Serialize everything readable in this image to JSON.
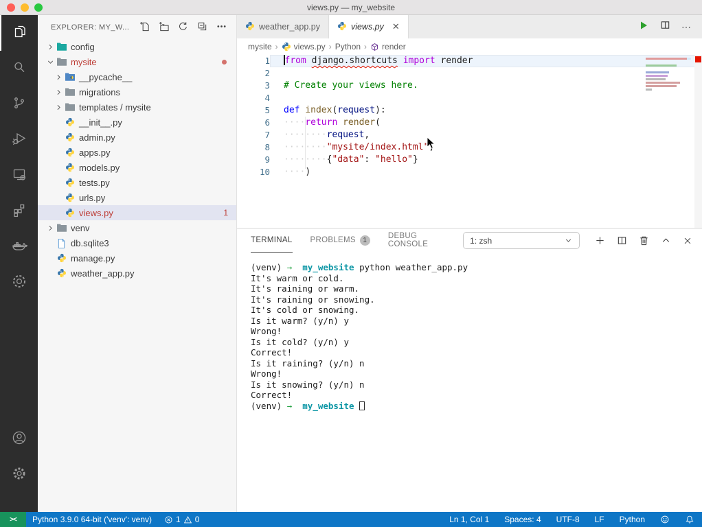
{
  "window": {
    "title": "views.py — my_website"
  },
  "activity_bar": {
    "top_items": [
      {
        "name": "explorer",
        "icon": "files-icon",
        "active": true
      },
      {
        "name": "search",
        "icon": "search-icon",
        "active": false
      },
      {
        "name": "source-control",
        "icon": "source-control-icon",
        "active": false
      },
      {
        "name": "run-and-debug",
        "icon": "run-debug-icon",
        "active": false
      },
      {
        "name": "remote-explorer",
        "icon": "remote-explorer-icon",
        "active": false
      },
      {
        "name": "extensions",
        "icon": "extensions-icon",
        "active": false
      },
      {
        "name": "docker",
        "icon": "docker-icon",
        "active": false
      },
      {
        "name": "python-environment",
        "icon": "circular-gear-icon",
        "active": false
      }
    ],
    "bottom_items": [
      {
        "name": "account",
        "icon": "account-icon"
      },
      {
        "name": "settings",
        "icon": "settings-gear-icon"
      }
    ]
  },
  "sidebar": {
    "header": "EXPLORER: MY_W...",
    "actions": [
      {
        "name": "new-file",
        "icon": "new-file-icon"
      },
      {
        "name": "new-folder",
        "icon": "new-folder-icon"
      },
      {
        "name": "refresh-explorer",
        "icon": "refresh-icon"
      },
      {
        "name": "collapse-folders",
        "icon": "collapse-folders-icon"
      },
      {
        "name": "more-actions",
        "icon": "more-actions-icon"
      }
    ],
    "tree": [
      {
        "label": "config",
        "indent": 0,
        "expandable": true,
        "expanded": false,
        "icon": "folder-teal"
      },
      {
        "label": "mysite",
        "indent": 0,
        "expandable": true,
        "expanded": true,
        "icon": "folder-grey",
        "modified": true,
        "dot": true
      },
      {
        "label": "__pycache__",
        "indent": 1,
        "expandable": true,
        "expanded": false,
        "icon": "folder-blue-python"
      },
      {
        "label": "migrations",
        "indent": 1,
        "expandable": true,
        "expanded": false,
        "icon": "folder-grey"
      },
      {
        "label": "templates / mysite",
        "indent": 1,
        "expandable": true,
        "expanded": false,
        "icon": "folder-grey"
      },
      {
        "label": "__init__.py",
        "indent": 1,
        "icon": "python"
      },
      {
        "label": "admin.py",
        "indent": 1,
        "icon": "python"
      },
      {
        "label": "apps.py",
        "indent": 1,
        "icon": "python"
      },
      {
        "label": "models.py",
        "indent": 1,
        "icon": "python"
      },
      {
        "label": "tests.py",
        "indent": 1,
        "icon": "python"
      },
      {
        "label": "urls.py",
        "indent": 1,
        "icon": "python"
      },
      {
        "label": "views.py",
        "indent": 1,
        "icon": "python",
        "selected": true,
        "modified": true,
        "badge": "1"
      },
      {
        "label": "venv",
        "indent": 0,
        "expandable": true,
        "expanded": false,
        "icon": "folder-grey"
      },
      {
        "label": "db.sqlite3",
        "indent": 0,
        "icon": "database-file"
      },
      {
        "label": "manage.py",
        "indent": 0,
        "icon": "python"
      },
      {
        "label": "weather_app.py",
        "indent": 0,
        "icon": "python"
      }
    ]
  },
  "editor": {
    "tabs": [
      {
        "label": "weather_app.py",
        "icon": "python",
        "active": false,
        "closable": false
      },
      {
        "label": "views.py",
        "icon": "python",
        "active": true,
        "preview": true,
        "closable": true,
        "close_glyph": "✕"
      }
    ],
    "breadcrumb": [
      {
        "label": "mysite"
      },
      {
        "label": "views.py",
        "icon": "python"
      },
      {
        "label": "Python"
      },
      {
        "label": "render",
        "icon": "symbol-method"
      }
    ],
    "breadcrumb_separator": "›",
    "code": [
      {
        "num": "1",
        "current": true,
        "cursor": true,
        "tokens": [
          [
            "kw",
            "from"
          ],
          [
            "pl",
            " "
          ],
          [
            "err",
            "django.shortcuts"
          ],
          [
            "pl",
            " "
          ],
          [
            "kw",
            "import"
          ],
          [
            "pl",
            " "
          ],
          [
            "pl",
            "render"
          ]
        ]
      },
      {
        "num": "2",
        "tokens": []
      },
      {
        "num": "3",
        "tokens": [
          [
            "cmt",
            "# Create your views here."
          ]
        ]
      },
      {
        "num": "4",
        "tokens": []
      },
      {
        "num": "5",
        "tokens": [
          [
            "def",
            "def"
          ],
          [
            "pl",
            " "
          ],
          [
            "fn",
            "index"
          ],
          [
            "pl",
            "("
          ],
          [
            "var",
            "request"
          ],
          [
            "pl",
            "):"
          ]
        ]
      },
      {
        "num": "6",
        "tokens": [
          [
            "ws",
            "····"
          ],
          [
            "kw",
            "return"
          ],
          [
            "pl",
            " "
          ],
          [
            "fn",
            "render"
          ],
          [
            "pl",
            "("
          ]
        ]
      },
      {
        "num": "7",
        "tokens": [
          [
            "ws",
            "········"
          ],
          [
            "var",
            "request"
          ],
          [
            "pl",
            ","
          ]
        ]
      },
      {
        "num": "8",
        "tokens": [
          [
            "ws",
            "········"
          ],
          [
            "str",
            "\"mysite/index.html\""
          ],
          [
            "pl",
            ","
          ]
        ]
      },
      {
        "num": "9",
        "tokens": [
          [
            "ws",
            "········"
          ],
          [
            "pl",
            "{"
          ],
          [
            "str",
            "\"data\""
          ],
          [
            "pl",
            ": "
          ],
          [
            "str",
            "\"hello\""
          ],
          [
            "pl",
            "}"
          ]
        ]
      },
      {
        "num": "10",
        "tokens": [
          [
            "ws",
            "····"
          ],
          [
            "pl",
            ")"
          ]
        ]
      }
    ]
  },
  "panel": {
    "tabs": [
      {
        "label": "TERMINAL",
        "active": true
      },
      {
        "label": "PROBLEMS",
        "badge": "1"
      },
      {
        "label": "DEBUG CONSOLE"
      }
    ],
    "shell_selector": {
      "value": "1: zsh"
    },
    "actions": [
      {
        "name": "new-terminal",
        "icon": "new-terminal-icon"
      },
      {
        "name": "split-terminal",
        "icon": "split-terminal-icon"
      },
      {
        "name": "kill-terminal",
        "icon": "kill-terminal-icon"
      },
      {
        "name": "maximize-panel",
        "icon": "maximize-panel-icon"
      },
      {
        "name": "close-panel",
        "icon": "close-panel-icon"
      }
    ],
    "terminal_lines": [
      {
        "tokens": [
          [
            "pl",
            "(venv) "
          ],
          [
            "arrow",
            "→"
          ],
          [
            "pl",
            "  "
          ],
          [
            "dir",
            "my_website"
          ],
          [
            "pl",
            " python weather_app.py"
          ]
        ]
      },
      {
        "tokens": [
          [
            "pl",
            "It's warm or cold."
          ]
        ]
      },
      {
        "tokens": [
          [
            "pl",
            "It's raining or warm."
          ]
        ]
      },
      {
        "tokens": [
          [
            "pl",
            "It's raining or snowing."
          ]
        ]
      },
      {
        "tokens": [
          [
            "pl",
            "It's cold or snowing."
          ]
        ]
      },
      {
        "tokens": [
          [
            "pl",
            "Is it warm? (y/n) y"
          ]
        ]
      },
      {
        "tokens": [
          [
            "pl",
            "Wrong!"
          ]
        ]
      },
      {
        "tokens": [
          [
            "pl",
            "Is it cold? (y/n) y"
          ]
        ]
      },
      {
        "tokens": [
          [
            "pl",
            "Correct!"
          ]
        ]
      },
      {
        "tokens": [
          [
            "pl",
            "Is it raining? (y/n) n"
          ]
        ]
      },
      {
        "tokens": [
          [
            "pl",
            "Wrong!"
          ]
        ]
      },
      {
        "tokens": [
          [
            "pl",
            "Is it snowing? (y/n) n"
          ]
        ]
      },
      {
        "tokens": [
          [
            "pl",
            "Correct!"
          ]
        ]
      },
      {
        "tokens": [
          [
            "pl",
            "(venv) "
          ],
          [
            "arrow",
            "→"
          ],
          [
            "pl",
            "  "
          ],
          [
            "dir",
            "my_website"
          ],
          [
            "pl",
            " "
          ],
          [
            "cursor",
            ""
          ]
        ]
      }
    ]
  },
  "status_bar": {
    "python_version": "Python 3.9.0 64-bit ('venv': venv)",
    "errors": "1",
    "warnings": "0",
    "cursor_position": "Ln 1, Col 1",
    "indentation": "Spaces: 4",
    "encoding": "UTF-8",
    "eol": "LF",
    "language": "Python"
  },
  "colors": {
    "status_blue": "#0e76c6",
    "remote_green": "#18935c",
    "error_red": "#e51400",
    "modified_red": "#bd3d36",
    "python_blue": "#3776AB",
    "python_yellow": "#FFD43B"
  }
}
